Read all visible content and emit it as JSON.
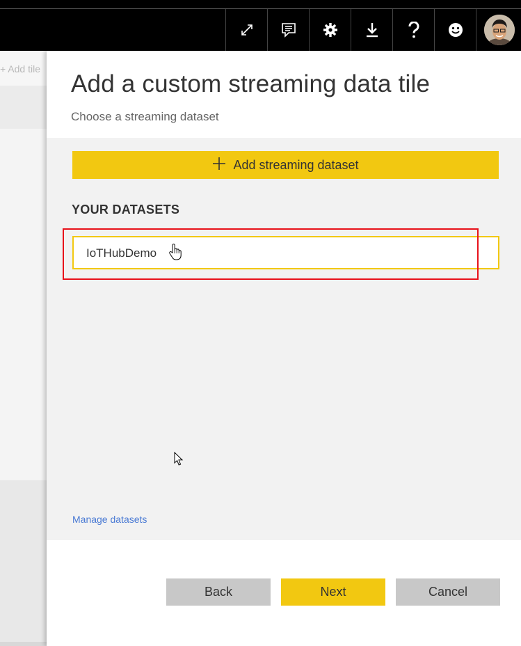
{
  "toolbar": {
    "icons": [
      "expand-icon",
      "comment-icon",
      "settings-icon",
      "download-icon",
      "help-icon",
      "smiley-icon",
      "user-avatar"
    ]
  },
  "background": {
    "add_tile_label": "+ Add tile"
  },
  "panel": {
    "title": "Add a custom streaming data tile",
    "subtitle": "Choose a streaming dataset",
    "add_button_label": "Add streaming dataset",
    "section_heading": "YOUR DATASETS",
    "datasets": [
      "IoTHubDemo"
    ],
    "manage_link": "Manage datasets",
    "buttons": {
      "back": "Back",
      "next": "Next",
      "cancel": "Cancel"
    }
  },
  "colors": {
    "accent": "#f2c811",
    "highlight_box": "#e8111a",
    "link": "#4a7ad4",
    "toolbar": "#000000"
  }
}
